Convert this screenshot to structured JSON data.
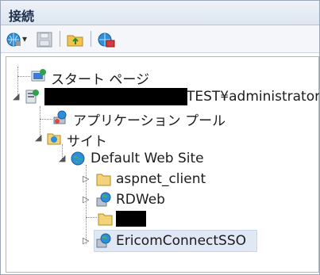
{
  "panel": {
    "title": "接続"
  },
  "toolbar": {
    "icons": [
      "connect-icon",
      "save-icon",
      "up-folder-icon",
      "disconnect-icon"
    ],
    "dropdown_glyph": "▾"
  },
  "tree": {
    "start_page": "スタート ページ",
    "server_suffix": "TEST¥administrator)",
    "app_pools": "アプリケーション プール",
    "sites": "サイト",
    "default_site": "Default Web Site",
    "aspnet_client": "aspnet_client",
    "rdweb": "RDWeb",
    "ericom": "EricomConnectSSO"
  },
  "glyphs": {
    "expand": "▷",
    "collapse": "◢"
  },
  "colors": {
    "header_text": "#1e2f4c",
    "folder": "#f2d27a",
    "globe": "#2d8fd8",
    "selection": "#dfe8f4"
  }
}
